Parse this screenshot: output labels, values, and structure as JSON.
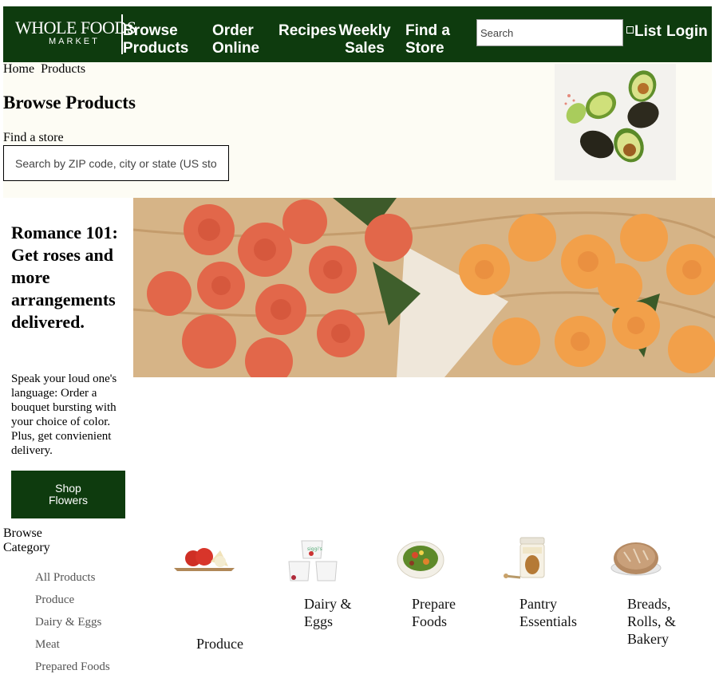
{
  "header": {
    "logo_main": "WHOLE FOODS",
    "logo_sub": "MARKET",
    "nav": [
      "Browse Products",
      "Order Online",
      "Recipes",
      "Weekly Sales",
      "Find a Store"
    ],
    "search_placeholder": "Search",
    "list_label": "List",
    "login_label": "Login",
    "background": "#0e3b0e"
  },
  "breadcrumb": [
    "Home",
    "Products"
  ],
  "page_title": "Browse Products",
  "store_finder": {
    "label": "Find a store",
    "placeholder": "Search by ZIP code, city or state (US stores)"
  },
  "promo": {
    "title": "Romance 101: Get roses and more arrangements delivered.",
    "text": "Speak your loud one's language: Order a bouquet bursting with your choice of color. Plus, get convienient delivery.",
    "button": "Shop Flowers"
  },
  "browse": {
    "heading": "Browse Category",
    "items": [
      "All Products",
      "Produce",
      "Dairy & Eggs",
      "Meat",
      "Prepared Foods"
    ]
  },
  "categories": [
    {
      "label": "Produce",
      "icon": "apples-icon"
    },
    {
      "label": "Dairy & Eggs",
      "icon": "yogurt-icon"
    },
    {
      "label": "Prepare Foods",
      "icon": "salad-bowl-icon"
    },
    {
      "label": "Pantry Essentials",
      "icon": "jar-icon"
    },
    {
      "label": "Breads, Rolls, & Bakery",
      "icon": "bread-icon"
    }
  ]
}
